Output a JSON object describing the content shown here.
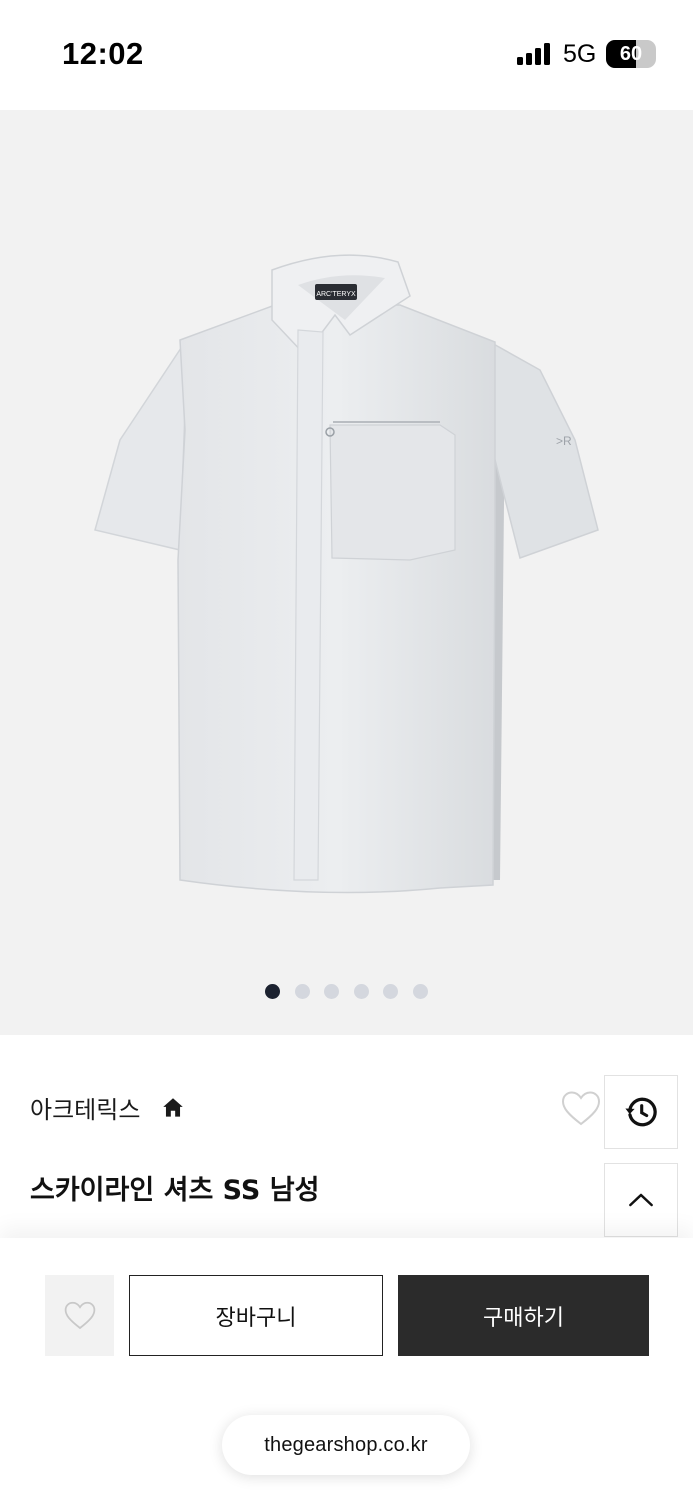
{
  "status_bar": {
    "time": "12:02",
    "network": "5G",
    "battery_level": "60",
    "battery_fraction": 0.6
  },
  "gallery": {
    "image_icon": "shirt-image",
    "image_count": 6,
    "active_index": 0,
    "active_dot_color": "#1c2230",
    "inactive_dot_color": "#d4d7de"
  },
  "product": {
    "brand": "아크테릭스",
    "title": "스카이라인 셔츠 SS 남성"
  },
  "icons": {
    "home": "home-icon",
    "wishlist": "heart-icon",
    "history": "history-icon",
    "scroll_top": "chevron-up-icon"
  },
  "actions": {
    "cart_label": "장바구니",
    "buy_label": "구매하기",
    "buy_color": "#2b2b2b"
  },
  "browser": {
    "url": "thegearshop.co.kr"
  }
}
